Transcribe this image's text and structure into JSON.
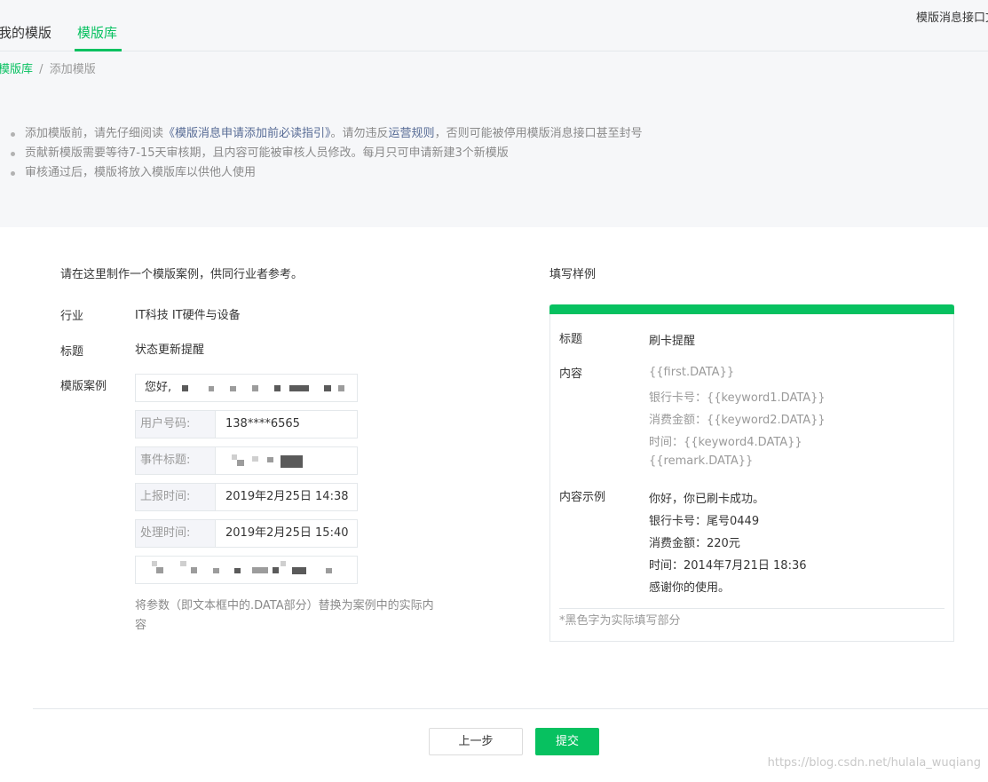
{
  "tabs": {
    "mine": "我的模版",
    "library": "模版库"
  },
  "top_link": "模版消息接口文",
  "breadcrumb": {
    "home": "模版库",
    "separator": "/",
    "current": "添加模版"
  },
  "notices": {
    "n1": {
      "a": "添加模版前，请先仔细阅读",
      "link1": "《模版消息申请添加前必读指引》",
      "b": "。请勿违反",
      "link2": "运营规则",
      "c": "，否则可能被停用模版消息接口甚至封号"
    },
    "n2": "贡献新模版需要等待7-15天审核期，且内容可能被审核人员修改。每月只可申请新建3个新模版",
    "n3": "审核通过后，模版将放入模版库以供他人使用"
  },
  "form": {
    "title": "请在这里制作一个模版案例，供同行业者参考。",
    "industry_label": "行业",
    "industry_value": "IT科技 IT硬件与设备",
    "title_label": "标题",
    "title_value": "状态更新提醒",
    "example_label": "模版案例",
    "greeting": "您好,",
    "fields": [
      {
        "label": "用户号码:",
        "value": "138****6565"
      },
      {
        "label": "事件标题:",
        "value": ""
      },
      {
        "label": "上报时间:",
        "value": "2019年2月25日 14:38"
      },
      {
        "label": "处理时间:",
        "value": "2019年2月25日 15:40"
      }
    ],
    "hint": "将参数（即文本框中的.DATA部分）替换为案例中的实际内容"
  },
  "sample": {
    "title": "填写样例",
    "title_label": "标题",
    "title_value": "刷卡提醒",
    "content_label": "内容",
    "content_lines": [
      "{{first.DATA}}",
      "银行卡号：{{keyword1.DATA}}",
      "消费金额：{{keyword2.DATA}}",
      "时间：{{keyword4.DATA}}",
      "{{remark.DATA}}"
    ],
    "example_label": "内容示例",
    "example_lines": [
      "你好，你已刷卡成功。",
      "银行卡号：尾号0449",
      "消费金额：220元",
      "时间：2014年7月21日 18:36",
      "感谢你的使用。"
    ],
    "note": "*黑色字为实际填写部分"
  },
  "buttons": {
    "prev": "上一步",
    "submit": "提交"
  },
  "watermark": "https://blog.csdn.net/hulala_wuqiang",
  "colors": {
    "accent": "#07c160",
    "link": "#576b95"
  }
}
